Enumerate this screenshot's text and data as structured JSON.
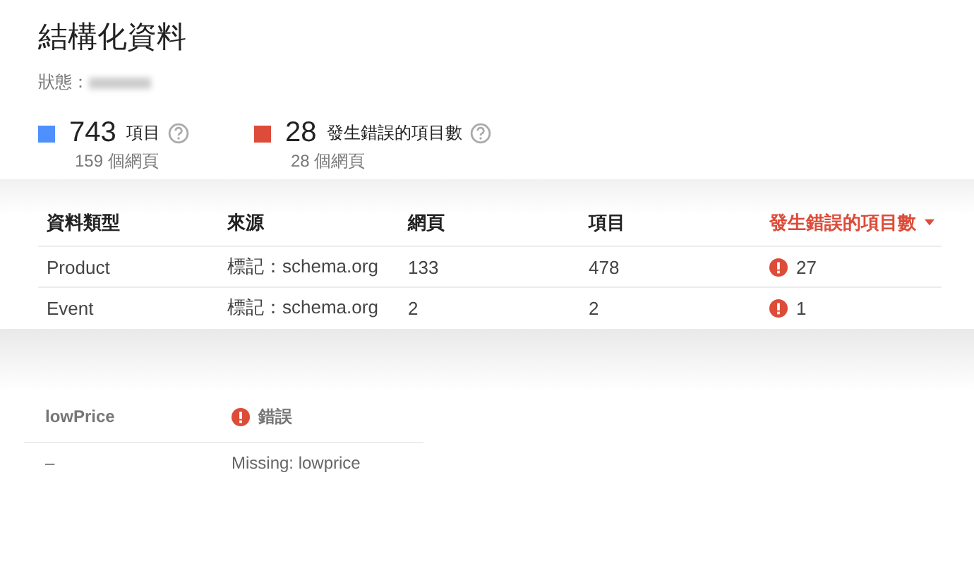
{
  "title": "結構化資料",
  "status_label": "狀態：",
  "summary": [
    {
      "count": "743",
      "label": "項目",
      "pages": "159 個網頁",
      "color": "#4d90fe"
    },
    {
      "count": "28",
      "label": "發生錯誤的項目數",
      "pages": "28 個網頁",
      "color": "#dd4b39"
    }
  ],
  "table": {
    "columns": [
      {
        "label": "資料類型",
        "selected": false
      },
      {
        "label": "來源",
        "selected": false
      },
      {
        "label": "網頁",
        "selected": false
      },
      {
        "label": "項目",
        "selected": false
      },
      {
        "label": "發生錯誤的項目數",
        "selected": true
      }
    ],
    "rows": [
      {
        "type": "Product",
        "source": "標記：schema.org",
        "pages": "133",
        "items": "478",
        "errors": "27"
      },
      {
        "type": "Event",
        "source": "標記：schema.org",
        "pages": "2",
        "items": "2",
        "errors": "1"
      }
    ]
  },
  "detail": {
    "property": "lowPrice",
    "status": "錯誤",
    "value": "–",
    "message": "Missing: lowprice"
  }
}
